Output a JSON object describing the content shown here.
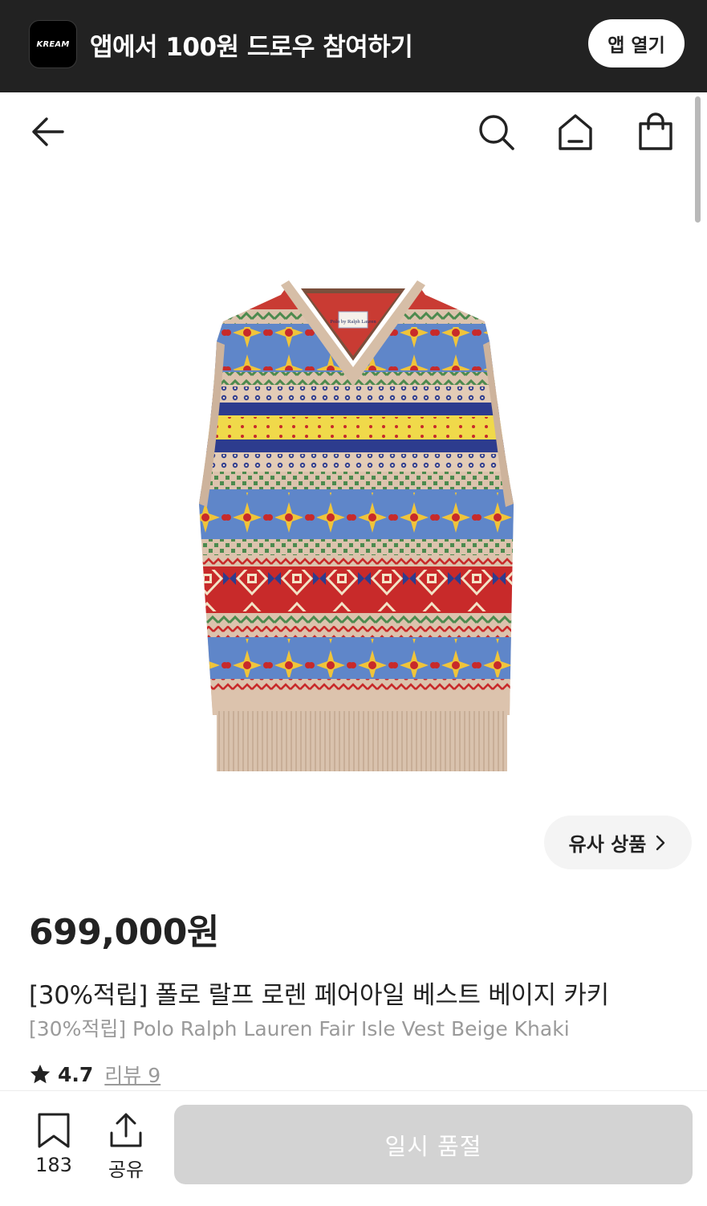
{
  "banner": {
    "logo_text": "KREAM",
    "message": "앱에서 100원 드로우 참여하기",
    "open_app_label": "앱 열기"
  },
  "nav": {
    "back_icon": "arrow-left-icon",
    "search_icon": "search-icon",
    "home_icon": "home-icon",
    "bag_icon": "shopping-bag-icon"
  },
  "product": {
    "image_label_text": "Polo by Ralph Lauren",
    "similar_label": "유사 상품",
    "price": "699,000원",
    "title_ko": "[30%적립] 폴로 랄프 로렌 페어아일 베스트 베이지 카키",
    "title_en": "[30%적립] Polo Ralph Lauren Fair Isle Vest Beige Khaki",
    "rating": "4.7",
    "review_link": "리뷰 9"
  },
  "bottom_bar": {
    "bookmark_count": "183",
    "share_label": "공유",
    "action_label": "일시 품절"
  },
  "colors": {
    "banner_bg": "#222222",
    "disabled_button": "#d3d3d3",
    "chip_bg": "#f4f4f4",
    "text_primary": "#222222",
    "text_secondary": "#9a9a9a"
  }
}
